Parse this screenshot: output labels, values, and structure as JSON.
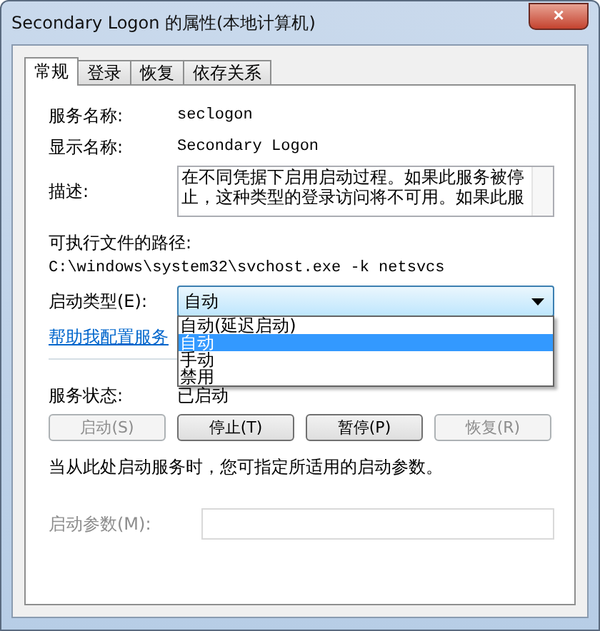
{
  "window": {
    "title": "Secondary Logon 的属性(本地计算机)",
    "close": "×"
  },
  "tabs": [
    {
      "label": "常规",
      "selected": true
    },
    {
      "label": "登录",
      "selected": false
    },
    {
      "label": "恢复",
      "selected": false
    },
    {
      "label": "依存关系",
      "selected": false
    }
  ],
  "info": [
    {
      "label": "服务名称:",
      "value": "seclogon"
    },
    {
      "label": "显示名称:",
      "value": "Secondary Logon"
    }
  ],
  "description": {
    "label": "描述:",
    "value": "在不同凭据下启用启动过程。如果此服务被停止，这种类型的登录访问将不可用。如果此服"
  },
  "path": {
    "label": "可执行文件的路径:",
    "value": "C:\\windows\\system32\\svchost.exe -k netsvcs"
  },
  "startup": {
    "label": "启动类型(E):",
    "value": "自动",
    "expanded": true,
    "options": [
      {
        "label": "自动(延迟启动)",
        "selected": false
      },
      {
        "label": "自动",
        "selected": true
      },
      {
        "label": "手动",
        "selected": false
      },
      {
        "label": "禁用",
        "selected": false
      }
    ]
  },
  "help_link": "帮助我配置服务",
  "status": {
    "label": "服务状态:",
    "value": "已启动"
  },
  "buttons": [
    {
      "label": "启动(S)",
      "disabled": true
    },
    {
      "label": "停止(T)",
      "disabled": false
    },
    {
      "label": "暂停(P)",
      "disabled": false
    },
    {
      "label": "恢复(R)",
      "disabled": true
    }
  ],
  "hint": "当从此处启动服务时，您可指定所适用的启动参数。",
  "params": {
    "label": "启动参数(M):",
    "disabled": true
  }
}
